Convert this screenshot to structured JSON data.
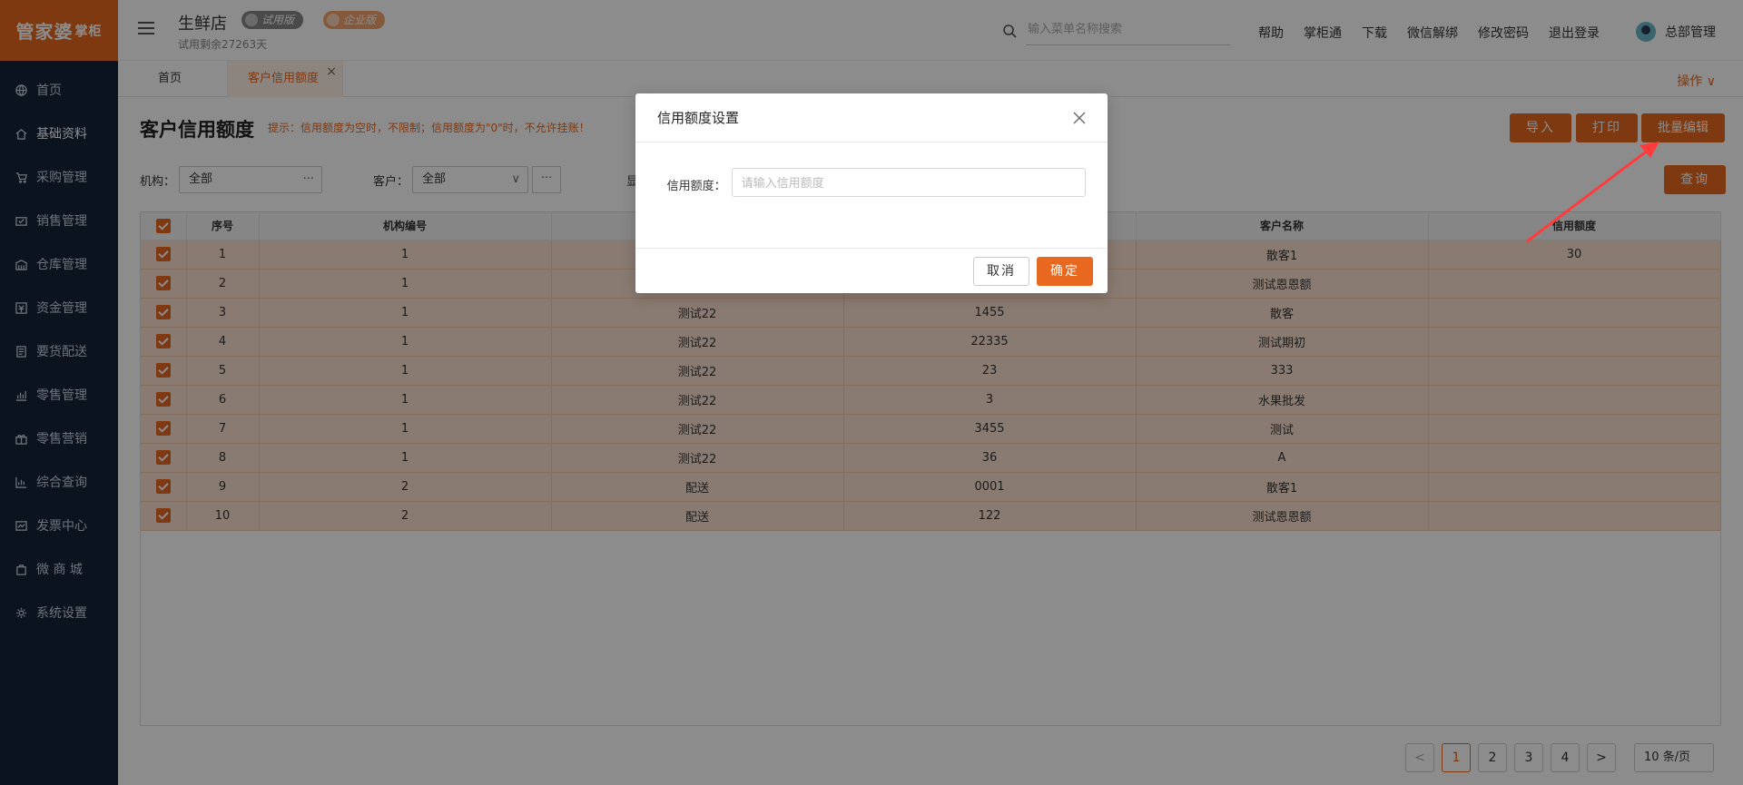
{
  "app": {
    "logo_text": "管家婆",
    "logo_sub": "掌柜",
    "store_name": "生鲜店",
    "badge_trial": "试用版",
    "badge_enterprise": "企业版",
    "trial_days": "试用剩余27263天"
  },
  "sidebar": {
    "items": [
      {
        "label": "首页",
        "icon": "globe-icon"
      },
      {
        "label": "基础资料",
        "icon": "home-icon"
      },
      {
        "label": "采购管理",
        "icon": "cart-icon"
      },
      {
        "label": "销售管理",
        "icon": "sales-icon"
      },
      {
        "label": "仓库管理",
        "icon": "warehouse-icon"
      },
      {
        "label": "资金管理",
        "icon": "money-icon"
      },
      {
        "label": "要货配送",
        "icon": "delivery-icon"
      },
      {
        "label": "零售管理",
        "icon": "retail-icon"
      },
      {
        "label": "零售营销",
        "icon": "gift-icon"
      },
      {
        "label": "综合查询",
        "icon": "chart-icon"
      },
      {
        "label": "发票中心",
        "icon": "invoice-icon"
      },
      {
        "label": "微 商 城",
        "icon": "bag-icon"
      },
      {
        "label": "系统设置",
        "icon": "gear-icon"
      }
    ]
  },
  "header": {
    "search_placeholder": "输入菜单名称搜索",
    "links": [
      "帮助",
      "掌柜通",
      "下载",
      "微信解绑",
      "修改密码",
      "退出登录"
    ],
    "user_name": "总部管理"
  },
  "tabs": {
    "home": "首页",
    "active": "客户信用额度",
    "ops": "操作 ∨"
  },
  "page": {
    "title": "客户信用额度",
    "hint": "提示：信用额度为空时，不限制；信用额度为\"0\"时，不允许挂账！",
    "btn_import": "导入",
    "btn_print": "打印",
    "btn_batch_edit": "批量编辑",
    "btn_query": "查询",
    "filter_org_label": "机构：",
    "filter_org_value": "全部",
    "filter_cust_label": "客户：",
    "filter_cust_value": "全部",
    "filter_show_label": "显示"
  },
  "table": {
    "headers": [
      "序号",
      "机构编号",
      "",
      "",
      "客户名称",
      "信用额度"
    ],
    "rows": [
      [
        "1",
        "1",
        "",
        "",
        "散客1",
        "30"
      ],
      [
        "2",
        "1",
        "",
        "",
        "测试恩恩额",
        ""
      ],
      [
        "3",
        "1",
        "测试22",
        "1455",
        "散客",
        ""
      ],
      [
        "4",
        "1",
        "测试22",
        "22335",
        "测试期初",
        ""
      ],
      [
        "5",
        "1",
        "测试22",
        "23",
        "333",
        ""
      ],
      [
        "6",
        "1",
        "测试22",
        "3",
        "水果批发",
        ""
      ],
      [
        "7",
        "1",
        "测试22",
        "3455",
        "测试",
        ""
      ],
      [
        "8",
        "1",
        "测试22",
        "36",
        "A",
        ""
      ],
      [
        "9",
        "2",
        "配送",
        "0001",
        "散客1",
        ""
      ],
      [
        "10",
        "2",
        "配送",
        "122",
        "测试恩恩额",
        ""
      ]
    ]
  },
  "pager": {
    "prev": "<",
    "pages": [
      "1",
      "2",
      "3",
      "4"
    ],
    "next": ">",
    "size": "10 条/页"
  },
  "modal": {
    "title": "信用额度设置",
    "label": "信用额度：",
    "placeholder": "请输入信用额度",
    "cancel": "取消",
    "ok": "确定"
  },
  "colors": {
    "accent": "#e8681f",
    "sidebar_bg": "#15233a"
  }
}
